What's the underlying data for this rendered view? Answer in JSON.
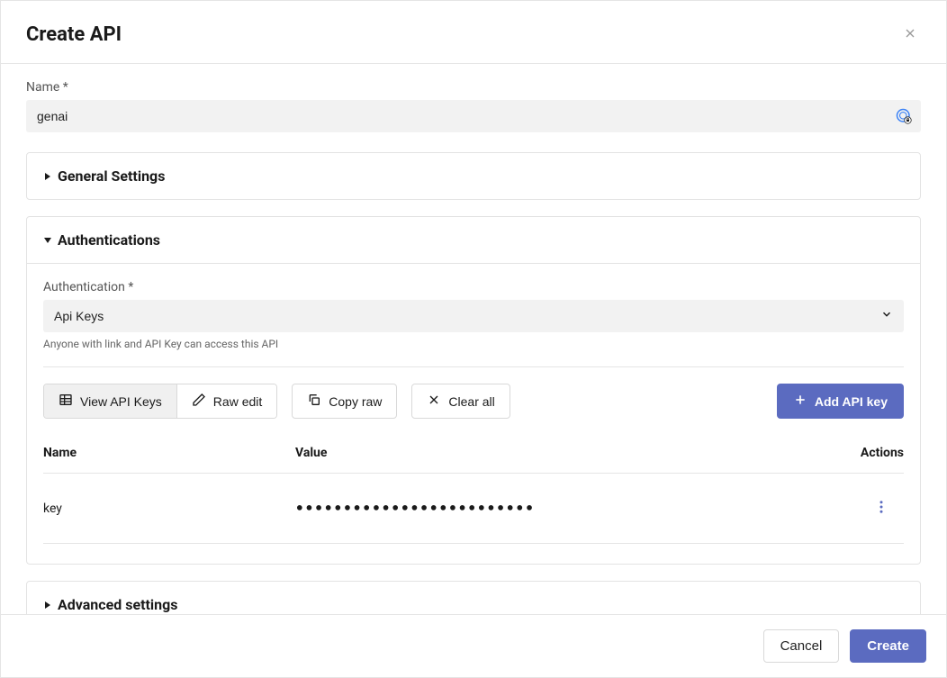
{
  "modal": {
    "title": "Create API"
  },
  "name_field": {
    "label": "Name *",
    "value": "genai"
  },
  "sections": {
    "general": {
      "title": "General Settings",
      "expanded": false
    },
    "auth": {
      "title": "Authentications",
      "expanded": true,
      "field_label": "Authentication *",
      "selected": "Api Keys",
      "help": "Anyone with link and API Key can access this API"
    },
    "advanced": {
      "title": "Advanced settings",
      "expanded": false
    }
  },
  "toolbar": {
    "view_keys": "View API Keys",
    "raw_edit": "Raw edit",
    "copy_raw": "Copy raw",
    "clear_all": "Clear all",
    "add_key": "Add API key"
  },
  "keys_table": {
    "headers": {
      "name": "Name",
      "value": "Value",
      "actions": "Actions"
    },
    "rows": [
      {
        "name": "key",
        "value_masked": "•••••••••••••••••••••••••"
      }
    ]
  },
  "footer": {
    "cancel": "Cancel",
    "create": "Create"
  }
}
